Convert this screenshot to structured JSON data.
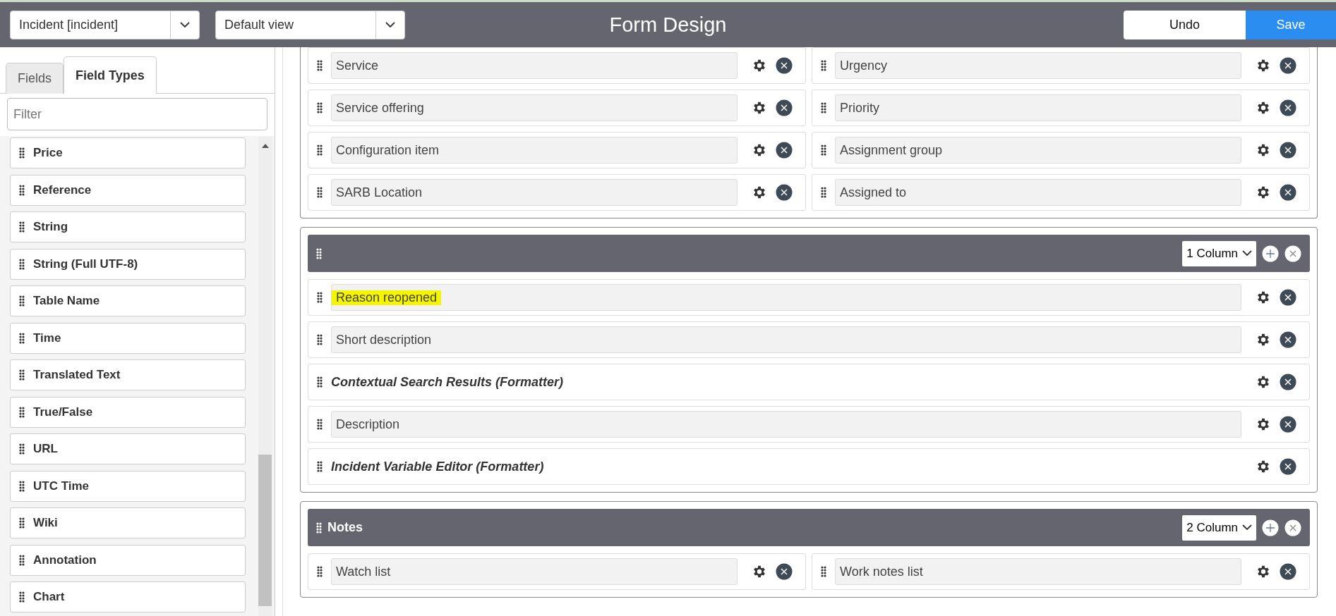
{
  "header": {
    "table_select": "Incident [incident]",
    "view_select": "Default view",
    "title": "Form Design",
    "buttons": [
      {
        "label": "Undo",
        "kind": "secondary"
      },
      {
        "label": "Save",
        "kind": "primary"
      }
    ]
  },
  "sidebar": {
    "tabs": [
      {
        "label": "Fields",
        "selected": false
      },
      {
        "label": "Field Types",
        "selected": true
      }
    ],
    "filter": {
      "placeholder": "Filter"
    },
    "items": [
      "Price",
      "Reference",
      "String",
      "String (Full UTF-8)",
      "Table Name",
      "Time",
      "Translated Text",
      "True/False",
      "URL",
      "UTC Time",
      "Wiki",
      "Annotation",
      "Chart"
    ]
  },
  "sections": [
    {
      "columns": [
        [
          {
            "kind": "field",
            "label": "Service",
            "highlighted": false
          },
          {
            "kind": "field",
            "label": "Service offering",
            "highlighted": false
          },
          {
            "kind": "field",
            "label": "Configuration item",
            "highlighted": false
          },
          {
            "kind": "field",
            "label": "SARB Location",
            "highlighted": false
          }
        ],
        [
          {
            "kind": "field",
            "label": "Urgency",
            "highlighted": false
          },
          {
            "kind": "field",
            "label": "Priority",
            "highlighted": false
          },
          {
            "kind": "field",
            "label": "Assignment group",
            "highlighted": false
          },
          {
            "kind": "field",
            "label": "Assigned to",
            "highlighted": false
          }
        ]
      ]
    },
    {
      "column_layout": "1 Column",
      "columns": [
        [
          {
            "kind": "field",
            "label": "Reason reopened",
            "highlighted": true
          },
          {
            "kind": "field",
            "label": "Short description",
            "highlighted": false
          },
          {
            "kind": "formatter",
            "label": "Contextual Search Results (Formatter)",
            "highlighted": false
          },
          {
            "kind": "field",
            "label": "Description",
            "highlighted": false
          },
          {
            "kind": "formatter",
            "label": "Incident Variable Editor (Formatter)",
            "highlighted": false
          }
        ]
      ]
    },
    {
      "title": "Notes",
      "column_layout": "2 Column",
      "columns": [
        [
          {
            "kind": "field",
            "label": "Watch list",
            "highlighted": false
          }
        ],
        [
          {
            "kind": "field",
            "label": "Work notes list",
            "highlighted": false
          }
        ]
      ]
    }
  ]
}
